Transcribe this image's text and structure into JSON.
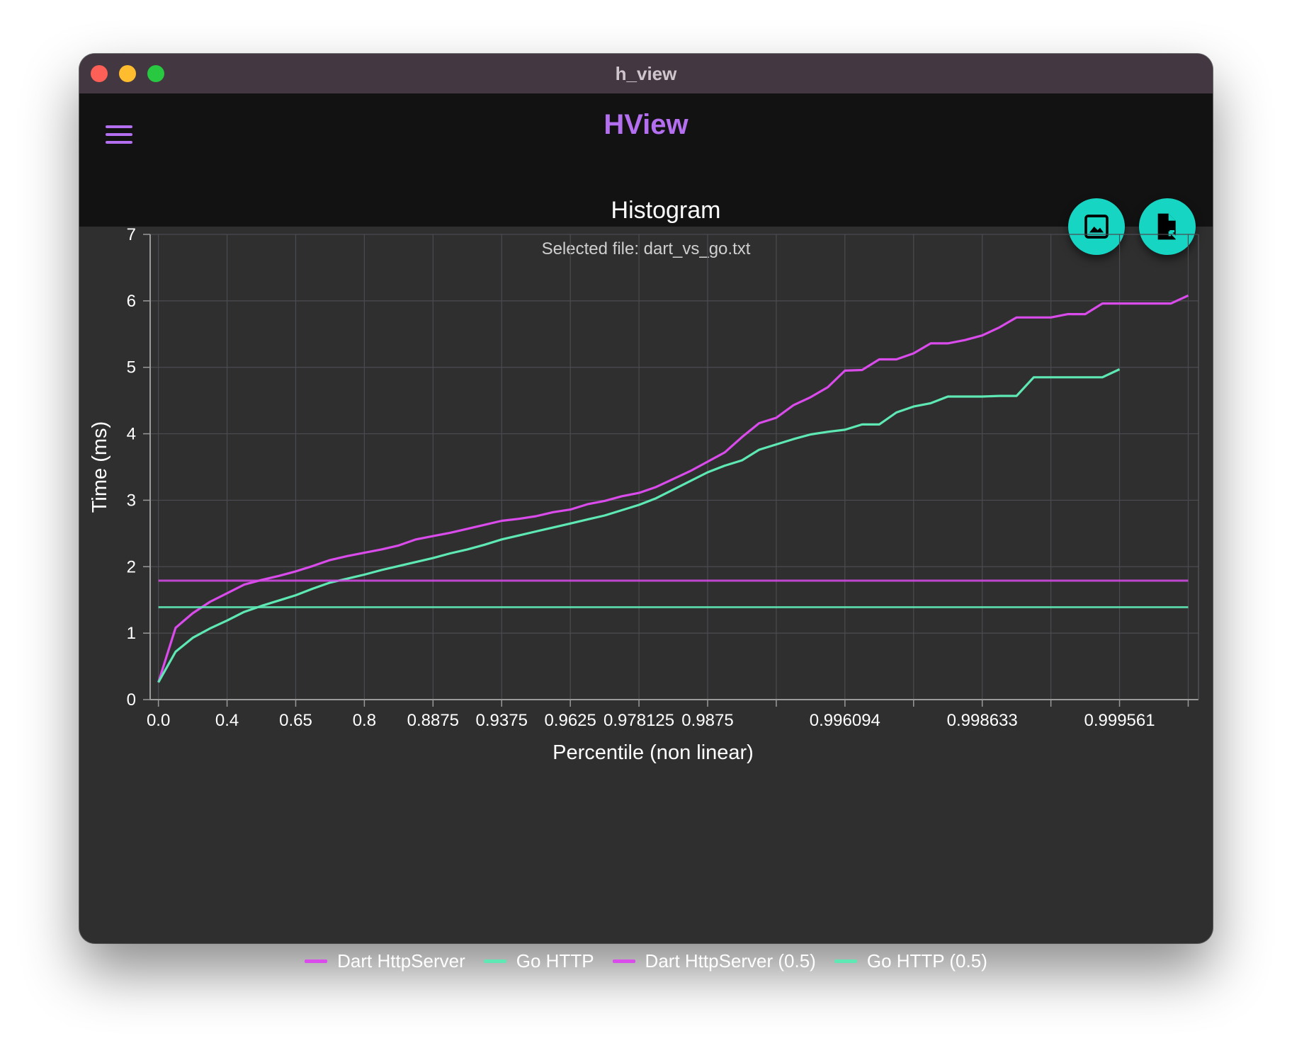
{
  "window": {
    "title": "h_view"
  },
  "appbar": {
    "title": "HView",
    "menu_icon": "hamburger-menu-icon"
  },
  "actions": [
    {
      "name": "export-image-button",
      "icon": "image-icon"
    },
    {
      "name": "open-file-button",
      "icon": "file-open-icon"
    }
  ],
  "selected_file": "Selected file: dart_vs_go.txt",
  "colors": {
    "accent": "#b46ff0",
    "fab": "#16d6c3",
    "dart": "#d94bea",
    "go": "#5ee8b4"
  },
  "chart_data": {
    "type": "line",
    "title": "Histogram",
    "xlabel": "Percentile (non linear)",
    "ylabel": "Time (ms)",
    "ylim": [
      0,
      7
    ],
    "yticks": [
      "0",
      "1",
      "2",
      "3",
      "4",
      "5",
      "6",
      "7"
    ],
    "xticks": [
      "0.0",
      "0.4",
      "0.65",
      "0.8",
      "0.8875",
      "0.9375",
      "0.9625",
      "0.978125",
      "0.9875",
      "0.996094",
      "0.998633",
      "0.999561"
    ],
    "x_positions": [
      0,
      1,
      2,
      3,
      4,
      5,
      6,
      7,
      8,
      10,
      12,
      14
    ],
    "xlim": [
      -0.12,
      15.15
    ],
    "grid": true,
    "legend_position": "bottom",
    "series": [
      {
        "name": "Dart HttpServer",
        "color": "#d94bea",
        "points": [
          [
            0,
            0.26
          ],
          [
            0.25,
            1.08
          ],
          [
            0.5,
            1.3
          ],
          [
            0.75,
            1.47
          ],
          [
            1,
            1.6
          ],
          [
            1.25,
            1.73
          ],
          [
            1.5,
            1.8
          ],
          [
            1.75,
            1.86
          ],
          [
            2,
            1.93
          ],
          [
            2.25,
            2.01
          ],
          [
            2.5,
            2.1
          ],
          [
            2.75,
            2.16
          ],
          [
            3,
            2.21
          ],
          [
            3.25,
            2.26
          ],
          [
            3.5,
            2.32
          ],
          [
            3.75,
            2.41
          ],
          [
            4,
            2.46
          ],
          [
            4.25,
            2.51
          ],
          [
            4.5,
            2.57
          ],
          [
            4.75,
            2.63
          ],
          [
            5,
            2.69
          ],
          [
            5.25,
            2.72
          ],
          [
            5.5,
            2.76
          ],
          [
            5.75,
            2.82
          ],
          [
            6,
            2.86
          ],
          [
            6.25,
            2.94
          ],
          [
            6.5,
            2.99
          ],
          [
            6.75,
            3.06
          ],
          [
            7,
            3.11
          ],
          [
            7.25,
            3.2
          ],
          [
            7.5,
            3.32
          ],
          [
            7.75,
            3.44
          ],
          [
            8,
            3.58
          ],
          [
            8.25,
            3.72
          ],
          [
            8.5,
            3.95
          ],
          [
            8.75,
            4.16
          ],
          [
            9,
            4.24
          ],
          [
            9.25,
            4.43
          ],
          [
            9.5,
            4.55
          ],
          [
            9.75,
            4.7
          ],
          [
            10,
            4.95
          ],
          [
            10.25,
            4.96
          ],
          [
            10.5,
            5.12
          ],
          [
            10.75,
            5.12
          ],
          [
            11,
            5.21
          ],
          [
            11.25,
            5.36
          ],
          [
            11.5,
            5.36
          ],
          [
            11.75,
            5.41
          ],
          [
            12,
            5.48
          ],
          [
            12.25,
            5.6
          ],
          [
            12.5,
            5.75
          ],
          [
            12.75,
            5.75
          ],
          [
            13,
            5.75
          ],
          [
            13.25,
            5.8
          ],
          [
            13.5,
            5.8
          ],
          [
            13.75,
            5.96
          ],
          [
            14,
            5.96
          ],
          [
            14.25,
            5.96
          ],
          [
            14.5,
            5.96
          ],
          [
            14.75,
            5.96
          ],
          [
            15,
            6.08
          ]
        ]
      },
      {
        "name": "Go HTTP",
        "color": "#5ee8b4",
        "points": [
          [
            0,
            0.26
          ],
          [
            0.25,
            0.72
          ],
          [
            0.5,
            0.93
          ],
          [
            0.75,
            1.07
          ],
          [
            1,
            1.19
          ],
          [
            1.25,
            1.32
          ],
          [
            1.5,
            1.41
          ],
          [
            1.75,
            1.49
          ],
          [
            2,
            1.57
          ],
          [
            2.25,
            1.67
          ],
          [
            2.5,
            1.76
          ],
          [
            2.75,
            1.82
          ],
          [
            3,
            1.88
          ],
          [
            3.25,
            1.95
          ],
          [
            3.5,
            2.01
          ],
          [
            3.75,
            2.07
          ],
          [
            4,
            2.13
          ],
          [
            4.25,
            2.2
          ],
          [
            4.5,
            2.26
          ],
          [
            4.75,
            2.33
          ],
          [
            5,
            2.41
          ],
          [
            5.25,
            2.47
          ],
          [
            5.5,
            2.53
          ],
          [
            5.75,
            2.59
          ],
          [
            6,
            2.65
          ],
          [
            6.25,
            2.71
          ],
          [
            6.5,
            2.77
          ],
          [
            6.75,
            2.85
          ],
          [
            7,
            2.93
          ],
          [
            7.25,
            3.03
          ],
          [
            7.5,
            3.16
          ],
          [
            7.75,
            3.29
          ],
          [
            8,
            3.42
          ],
          [
            8.25,
            3.52
          ],
          [
            8.5,
            3.6
          ],
          [
            8.75,
            3.76
          ],
          [
            9,
            3.84
          ],
          [
            9.25,
            3.92
          ],
          [
            9.5,
            3.99
          ],
          [
            9.75,
            4.03
          ],
          [
            10,
            4.06
          ],
          [
            10.25,
            4.14
          ],
          [
            10.5,
            4.14
          ],
          [
            10.75,
            4.32
          ],
          [
            11,
            4.41
          ],
          [
            11.25,
            4.46
          ],
          [
            11.5,
            4.56
          ],
          [
            11.75,
            4.56
          ],
          [
            12,
            4.56
          ],
          [
            12.25,
            4.57
          ],
          [
            12.5,
            4.57
          ],
          [
            12.75,
            4.85
          ],
          [
            13,
            4.85
          ],
          [
            13.25,
            4.85
          ],
          [
            13.5,
            4.85
          ],
          [
            13.75,
            4.85
          ],
          [
            14,
            4.97
          ]
        ]
      },
      {
        "name": "Dart HttpServer (0.5)",
        "color": "#d94bea",
        "constant": 1.79,
        "x_range": [
          0,
          15
        ]
      },
      {
        "name": "Go HTTP (0.5)",
        "color": "#5ee8b4",
        "constant": 1.39,
        "x_range": [
          0,
          15
        ]
      }
    ]
  }
}
